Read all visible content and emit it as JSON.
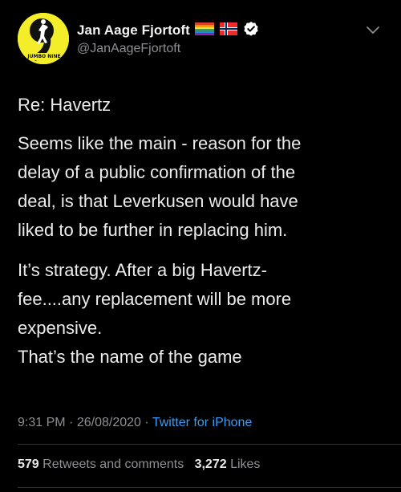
{
  "user": {
    "display_name": "Jan Aage Fjortoft",
    "handle": "@JanAageFjortoft",
    "avatar_text": "JUMBO NINE",
    "avatar_color": "#f4ee2a"
  },
  "tweet": {
    "intro": "Re: Havertz",
    "paragraph_1": [
      "Seems like the main - reason for the",
      "delay of a public confirmation of the",
      "deal, is that Leverkusen would have",
      "liked to be further in replacing him."
    ],
    "paragraph_2": [
      "It’s strategy. After a big Havertz-",
      "fee....any replacement will be more",
      "expensive.",
      "That’s the name of the game"
    ]
  },
  "meta": {
    "time": "9:31 PM",
    "separator": "·",
    "date": "26/08/2020",
    "source": "Twitter for iPhone",
    "source_color": "#3b9df5"
  },
  "stats": {
    "retweets_count": "579",
    "retweets_label": "Retweets and comments",
    "likes_count": "3,272",
    "likes_label": "Likes"
  },
  "icons": {
    "rainbow_flag": "rainbow-flag-icon",
    "norway_flag": "norway-flag-icon",
    "verified": "verified-badge-icon",
    "more": "chevron-down-icon"
  }
}
